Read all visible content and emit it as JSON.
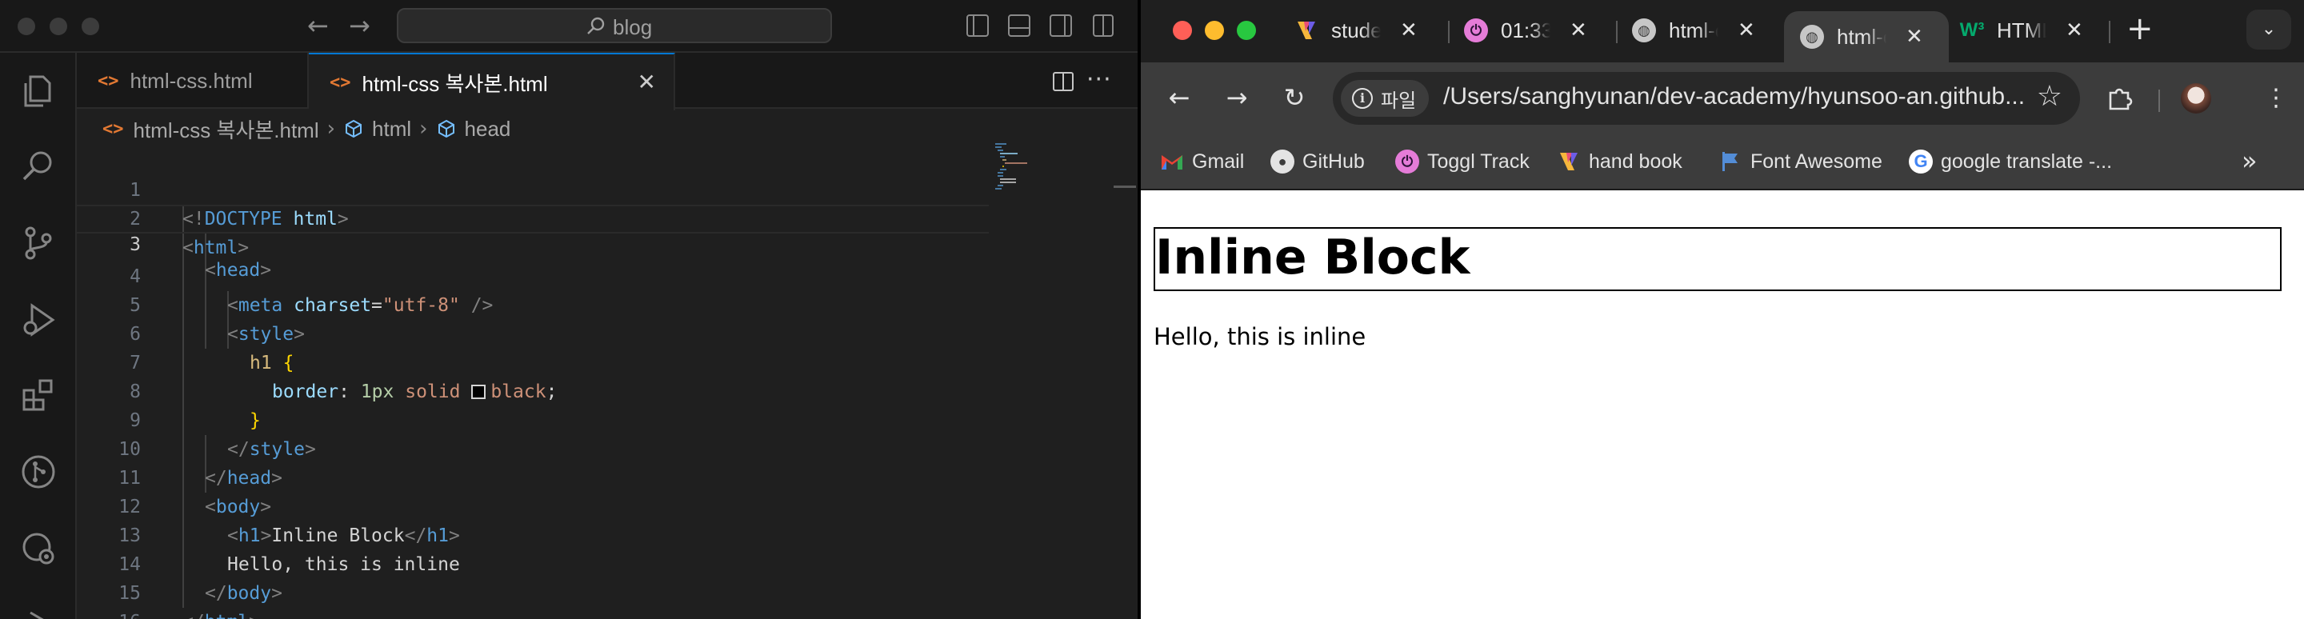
{
  "vscode": {
    "command_center": {
      "text": "blog"
    },
    "tabs": [
      {
        "label": "html-css.html",
        "active": false
      },
      {
        "label": "html-css 복사본.html",
        "active": true
      }
    ],
    "breadcrumb": {
      "file": "html-css 복사본.html",
      "items": [
        "html",
        "head"
      ]
    },
    "line_numbers": [
      "1",
      "2",
      "3",
      "4",
      "5",
      "6",
      "7",
      "8",
      "9",
      "10",
      "11",
      "12",
      "13",
      "14",
      "15",
      "16"
    ],
    "active_line": "3",
    "code": {
      "l1": {
        "open": "<!",
        "kw": "DOCTYPE",
        "name": "html",
        "close": ">"
      },
      "l2": {
        "open": "<",
        "tag": "html",
        "close": ">"
      },
      "l3": {
        "open": "<",
        "tag": "head",
        "close": ">"
      },
      "l4": {
        "open": "<",
        "tag": "meta",
        "attr": "charset",
        "eq": "=",
        "val": "\"utf-8\"",
        "close": " />"
      },
      "l5": {
        "open": "<",
        "tag": "style",
        "close": ">"
      },
      "l6": {
        "selector": "h1",
        "brace": "{"
      },
      "l7": {
        "prop": "border",
        "colon": ":",
        "num": "1px",
        "kw": "solid",
        "color": "black",
        "semi": ";"
      },
      "l8": {
        "brace": "}"
      },
      "l9": {
        "open": "</",
        "tag": "style",
        "close": ">"
      },
      "l10": {
        "open": "</",
        "tag": "head",
        "close": ">"
      },
      "l11": {
        "open": "<",
        "tag": "body",
        "close": ">"
      },
      "l12": {
        "open": "<",
        "tag": "h1",
        "close": ">",
        "text": "Inline Block",
        "open2": "</",
        "tag2": "h1",
        "close2": ">"
      },
      "l13": {
        "text": "Hello, this is inline"
      },
      "l14": {
        "open": "</",
        "tag": "body",
        "close": ">"
      },
      "l15": {
        "open": "</",
        "tag": "html",
        "close": ">"
      }
    },
    "colors": {
      "background": "#1f1f1f",
      "accent": "#0078d4",
      "html_icon": "#e37933"
    }
  },
  "chrome": {
    "tabs": [
      {
        "label": "stude",
        "favicon": "hand-book-icon",
        "active": false
      },
      {
        "label": "01:33",
        "favicon": "toggl-icon",
        "active": false
      },
      {
        "label": "html-c",
        "favicon": "globe-icon",
        "active": false
      },
      {
        "label": "html-c",
        "favicon": "globe-icon",
        "active": true
      },
      {
        "label": "HTML",
        "favicon": "w3schools-icon",
        "active": false
      }
    ],
    "site_chip": "파일",
    "url": "/Users/sanghyunan/dev-academy/hyunsoo-an.github...",
    "bookmarks": [
      {
        "label": "Gmail",
        "icon": "gmail-icon"
      },
      {
        "label": "GitHub",
        "icon": "github-icon"
      },
      {
        "label": "Toggl Track",
        "icon": "toggl-icon"
      },
      {
        "label": "hand book",
        "icon": "hand-book-icon"
      },
      {
        "label": "Font Awesome",
        "icon": "font-awesome-icon"
      },
      {
        "label": "google translate -...",
        "icon": "google-icon"
      }
    ],
    "page": {
      "heading": "Inline Block",
      "text": "Hello, this is inline"
    }
  }
}
